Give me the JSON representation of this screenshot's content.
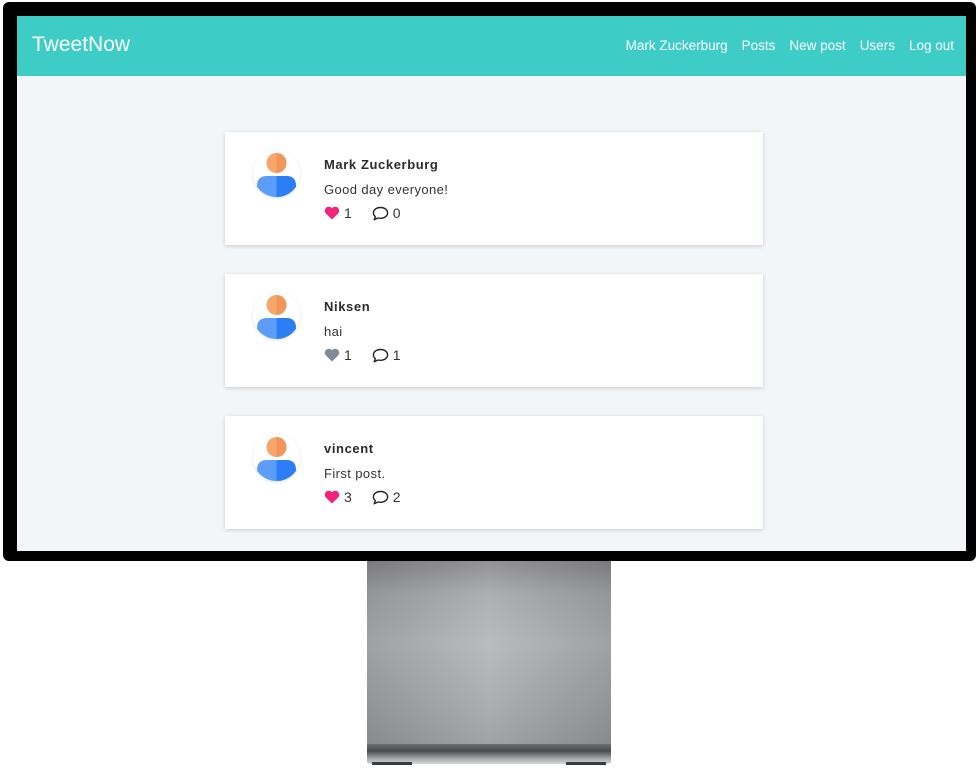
{
  "app": {
    "brand": "TweetNow"
  },
  "nav": {
    "items": [
      {
        "label": "Mark Zuckerburg"
      },
      {
        "label": "Posts"
      },
      {
        "label": "New post"
      },
      {
        "label": "Users"
      },
      {
        "label": "Log out"
      }
    ]
  },
  "colors": {
    "navbar": "#3ecdc6",
    "liked": "#f2227d",
    "unliked": "#7f8b96"
  },
  "posts": [
    {
      "author": "Mark Zuckerburg",
      "text": "Good day everyone!",
      "likes": "1",
      "comments": "0",
      "liked": true,
      "like_icon": "heart-icon",
      "comment_icon": "comment-icon"
    },
    {
      "author": "Niksen",
      "text": "hai",
      "likes": "1",
      "comments": "1",
      "liked": false,
      "like_icon": "heart-icon",
      "comment_icon": "comment-icon"
    },
    {
      "author": "vincent",
      "text": "First post.",
      "likes": "3",
      "comments": "2",
      "liked": true,
      "like_icon": "heart-icon",
      "comment_icon": "comment-icon"
    }
  ]
}
